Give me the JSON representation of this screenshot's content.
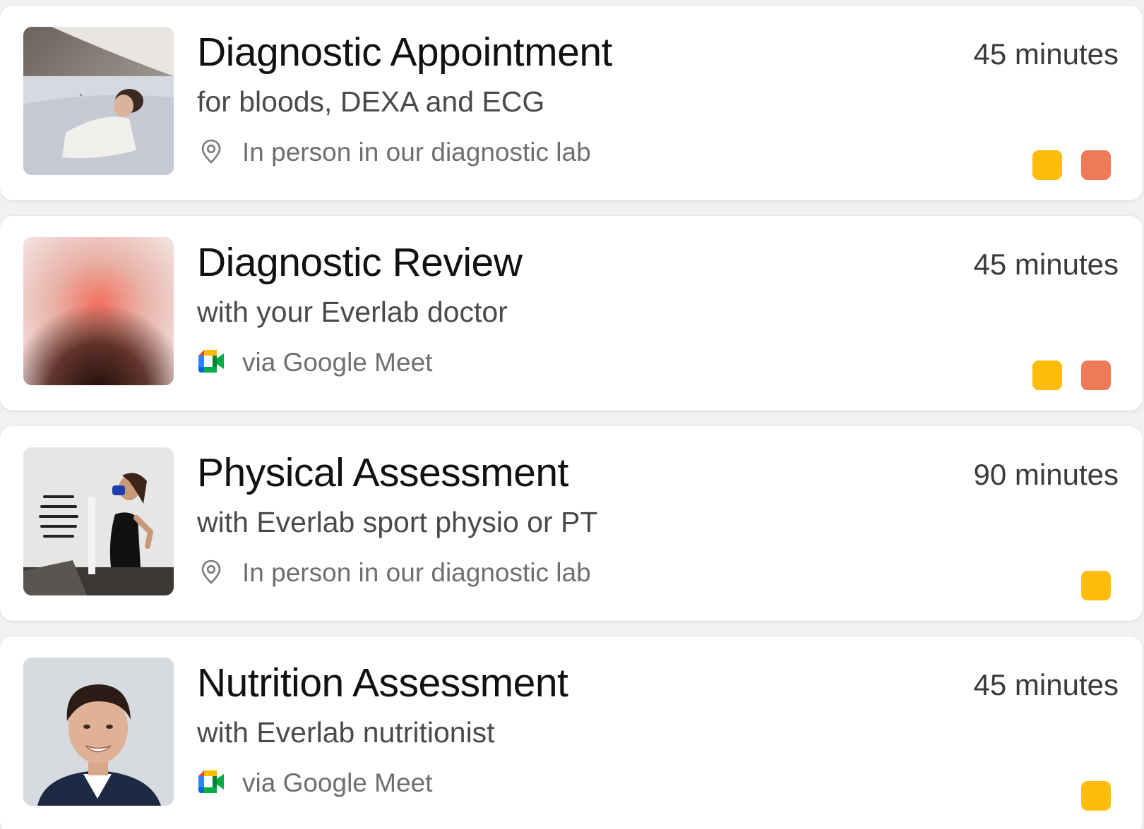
{
  "colors": {
    "dot_yellow": "#FFBC0A",
    "dot_orange": "#EE7A57"
  },
  "appointments": [
    {
      "title": "Diagnostic Appointment",
      "subtitle": "for bloods, DEXA and ECG",
      "location_icon": "map-pin-icon",
      "location": "In person in our diagnostic lab",
      "duration": "45 minutes",
      "thumbnail": "patient-scan-photo",
      "tags": [
        "yellow",
        "orange"
      ]
    },
    {
      "title": "Diagnostic Review",
      "subtitle": "with your Everlab doctor",
      "location_icon": "google-meet-icon",
      "location": "via Google Meet",
      "duration": "45 minutes",
      "thumbnail": "gradient-abstract-image",
      "tags": [
        "yellow",
        "orange"
      ]
    },
    {
      "title": "Physical Assessment",
      "subtitle": "with Everlab sport physio or PT",
      "location_icon": "map-pin-icon",
      "location": "In person in our diagnostic lab",
      "duration": "90 minutes",
      "thumbnail": "treadmill-test-photo",
      "tags": [
        "yellow"
      ]
    },
    {
      "title": "Nutrition Assessment",
      "subtitle": "with Everlab nutritionist",
      "location_icon": "google-meet-icon",
      "location": "via Google Meet",
      "duration": "45 minutes",
      "thumbnail": "nutritionist-portrait-photo",
      "tags": [
        "yellow"
      ]
    }
  ]
}
